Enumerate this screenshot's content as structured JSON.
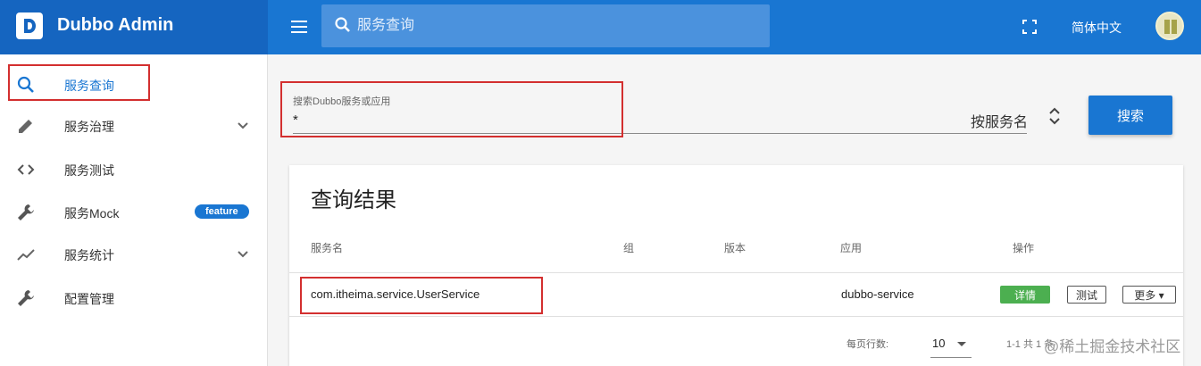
{
  "app": {
    "title": "Dubbo Admin",
    "logo_letter": "D"
  },
  "topbar": {
    "search_placeholder": "服务查询",
    "language": "简体中文",
    "colors": {
      "sidebar_header": "#1565c0",
      "topbar": "#1976d2"
    }
  },
  "sidebar": {
    "items": [
      {
        "label": "服务查询",
        "icon": "search-icon",
        "active": true
      },
      {
        "label": "服务治理",
        "icon": "pencil-icon",
        "expandable": true
      },
      {
        "label": "服务测试",
        "icon": "code-icon"
      },
      {
        "label": "服务Mock",
        "icon": "wrench-icon",
        "badge": "feature"
      },
      {
        "label": "服务统计",
        "icon": "trending-icon",
        "expandable": true
      },
      {
        "label": "配置管理",
        "icon": "wrench-icon"
      }
    ]
  },
  "query": {
    "label": "搜索Dubbo服务或应用",
    "value": "*",
    "type_selected": "按服务名",
    "search_button": "搜索"
  },
  "results": {
    "title": "查询结果",
    "columns": [
      "服务名",
      "组",
      "版本",
      "应用",
      "操作"
    ],
    "rows": [
      {
        "service": "com.itheima.service.UserService",
        "group": "",
        "version": "",
        "application": "dubbo-service",
        "actions": {
          "detail": "详情",
          "test": "测试",
          "more": "更多"
        }
      }
    ],
    "pagination": {
      "rows_per_page_label": "每页行数:",
      "rows_per_page": "10",
      "range": "1-1 共 1 条"
    }
  },
  "watermark": "@稀土掘金技术社区"
}
